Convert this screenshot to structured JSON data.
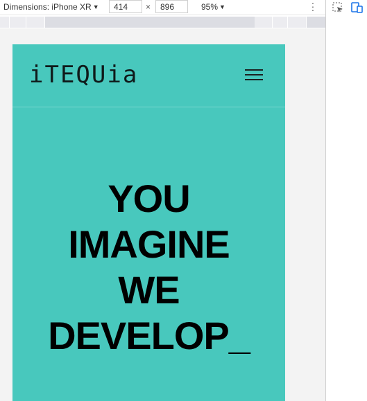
{
  "devtools": {
    "dimensions_label": "Dimensions: iPhone XR",
    "width_value": "414",
    "times_symbol": "×",
    "height_value": "896",
    "zoom_label": "95%"
  },
  "site": {
    "logo_text": "iTEQUia",
    "hero_lines": [
      "YOU",
      "IMAGINE",
      "WE",
      "DEVELOP_"
    ]
  },
  "colors": {
    "brand_teal": "#48c8bd",
    "text_dark": "#000000"
  },
  "icons": {
    "menu": "hamburger-menu-icon",
    "inspect": "inspect-element-icon",
    "device": "device-toolbar-icon",
    "more": "more-options-icon"
  }
}
